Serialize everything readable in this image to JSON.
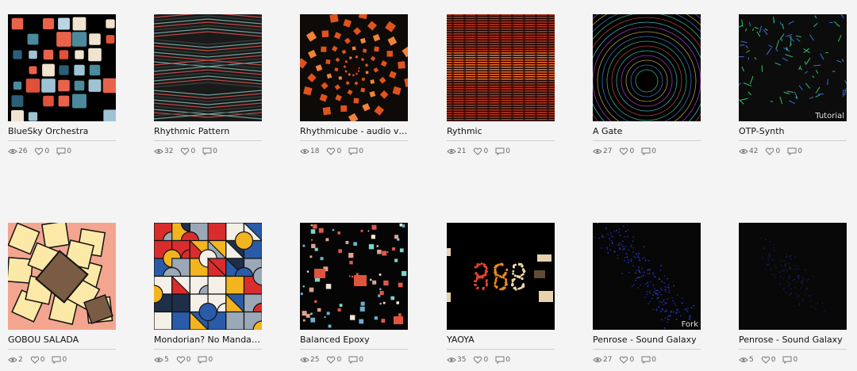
{
  "items": [
    {
      "title": "BlueSky Orchestra",
      "views": "26",
      "likes": "0",
      "comments": "0",
      "badge": "",
      "thumb": "bluesky"
    },
    {
      "title": "Rhythmic Pattern",
      "views": "32",
      "likes": "0",
      "comments": "0",
      "badge": "",
      "thumb": "pattern"
    },
    {
      "title": "Rhythmicube - audio visua...",
      "views": "18",
      "likes": "0",
      "comments": "0",
      "badge": "",
      "thumb": "cube"
    },
    {
      "title": "Rythmic",
      "views": "21",
      "likes": "0",
      "comments": "0",
      "badge": "",
      "thumb": "rythmic"
    },
    {
      "title": "A Gate",
      "views": "27",
      "likes": "0",
      "comments": "0",
      "badge": "",
      "thumb": "gate"
    },
    {
      "title": "OTP-Synth",
      "views": "42",
      "likes": "0",
      "comments": "0",
      "badge": "Tutorial",
      "thumb": "otp"
    },
    {
      "title": "GOBOU SALADA",
      "views": "2",
      "likes": "0",
      "comments": "0",
      "badge": "",
      "thumb": "gobou"
    },
    {
      "title": "Mondorian? No Mandaloria...",
      "views": "5",
      "likes": "0",
      "comments": "0",
      "badge": "",
      "thumb": "mondorian"
    },
    {
      "title": "Balanced Epoxy",
      "views": "25",
      "likes": "0",
      "comments": "0",
      "badge": "",
      "thumb": "epoxy"
    },
    {
      "title": "YAOYA",
      "views": "35",
      "likes": "0",
      "comments": "0",
      "badge": "",
      "thumb": "yaoya"
    },
    {
      "title": "Penrose - Sound Galaxy",
      "views": "27",
      "likes": "0",
      "comments": "0",
      "badge": "Fork",
      "thumb": "penrose1"
    },
    {
      "title": "Penrose - Sound Galaxy",
      "views": "5",
      "likes": "0",
      "comments": "0",
      "badge": "",
      "thumb": "penrose2"
    }
  ],
  "icons": {
    "views": "eye-icon",
    "likes": "heart-icon",
    "comments": "comment-icon"
  },
  "colors": {
    "background": "#f4f4f4",
    "title": "#111111",
    "stat": "#666666",
    "rule": "#cfcfcf"
  }
}
